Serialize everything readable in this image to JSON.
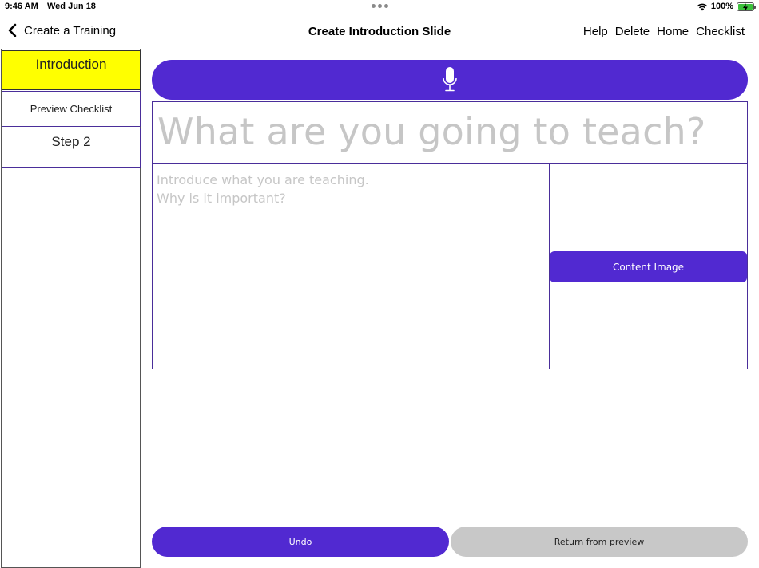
{
  "status_bar": {
    "time": "9:46 AM",
    "date": "Wed Jun 18",
    "battery": "100%",
    "battery_level": 1.0,
    "battery_color": "#3cc13c"
  },
  "nav": {
    "back_label": "Create a Training",
    "title": "Create Introduction Slide",
    "actions": [
      "Help",
      "Delete",
      "Home",
      "Checklist"
    ]
  },
  "sidebar": {
    "items": [
      {
        "label": "Introduction",
        "selected": true
      },
      {
        "label": "Preview Checklist",
        "selected": false
      },
      {
        "label": "Step 2",
        "selected": false
      }
    ]
  },
  "editor": {
    "mic_icon": "microphone-icon",
    "title_placeholder": "What are you going to teach?",
    "intro_placeholder_lines": [
      "Introduce what you are teaching.",
      "Why is it important?"
    ],
    "content_image_label": "Content Image"
  },
  "footer": {
    "undo_label": "Undo",
    "return_label": "Return from preview"
  },
  "colors": {
    "accent": "#5129d1",
    "selected_item": "#ffff00",
    "border": "#4a2e9a",
    "placeholder": "#c6c6c6",
    "disabled_button": "#c8c8c8"
  }
}
